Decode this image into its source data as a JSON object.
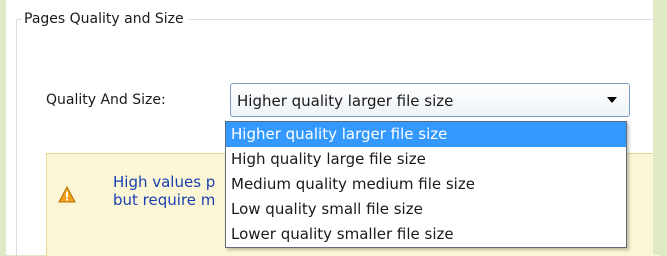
{
  "group": {
    "title": "Pages Quality and Size"
  },
  "quality_size": {
    "label": "Quality And Size:",
    "selected_value": "Higher quality larger file size",
    "options": [
      "Higher quality larger file size",
      "High quality large file size",
      "Medium quality medium file size",
      "Low quality small file size",
      "Lower quality smaller file size"
    ],
    "highlighted_index": 0
  },
  "warning": {
    "line1": "High values p",
    "line2": "but require m",
    "icon": "warning-icon"
  },
  "colors": {
    "highlight": "#3399ff",
    "warning_text": "#1a3fb0",
    "warning_background": "#fbf6d5",
    "outer_background": "#dfe9c6"
  }
}
